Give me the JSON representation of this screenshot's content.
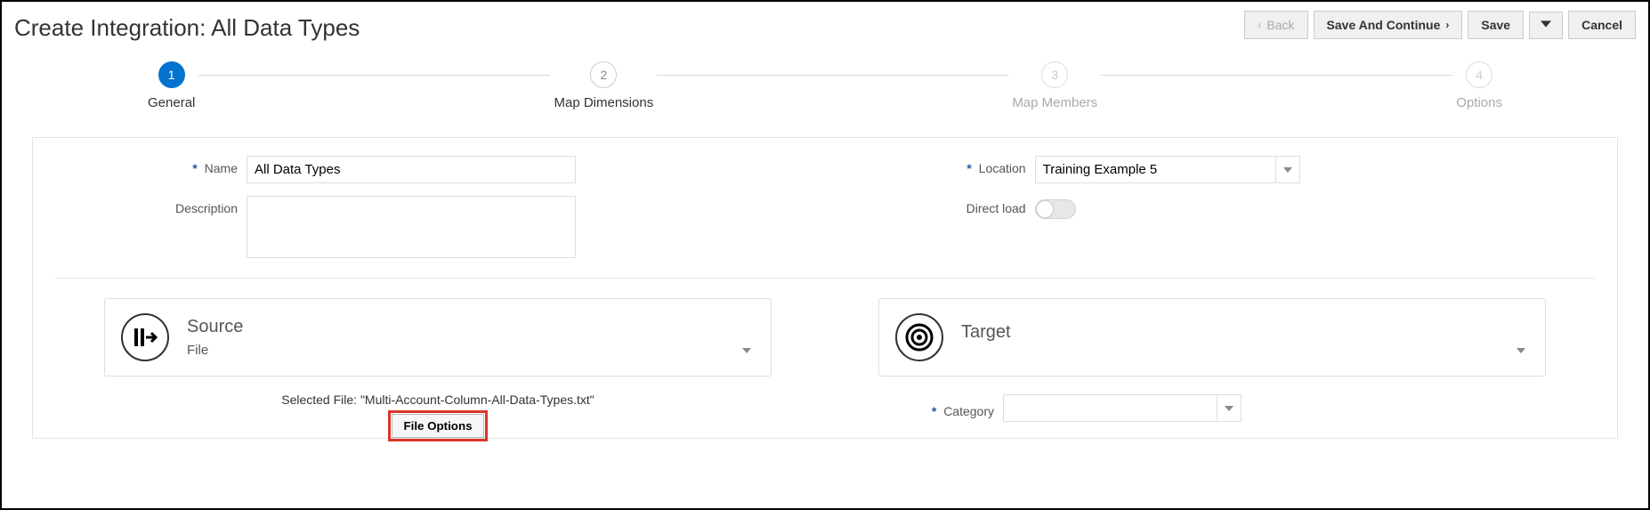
{
  "title": "Create Integration: All Data Types",
  "actions": {
    "back": "Back",
    "save_continue": "Save And Continue",
    "save": "Save",
    "cancel": "Cancel"
  },
  "steps": [
    {
      "num": "1",
      "label": "General"
    },
    {
      "num": "2",
      "label": "Map Dimensions"
    },
    {
      "num": "3",
      "label": "Map Members"
    },
    {
      "num": "4",
      "label": "Options"
    }
  ],
  "fields": {
    "name_label": "Name",
    "name_value": "All Data Types",
    "description_label": "Description",
    "description_value": "",
    "location_label": "Location",
    "location_value": "Training Example 5",
    "direct_load_label": "Direct load"
  },
  "source": {
    "title": "Source",
    "value": "File",
    "selected_file_prefix": "Selected File: ",
    "selected_file_name": "\"Multi-Account-Column-All-Data-Types.txt\"",
    "file_options_label": "File Options"
  },
  "target": {
    "title": "Target",
    "value": "",
    "category_label": "Category",
    "category_value": ""
  }
}
